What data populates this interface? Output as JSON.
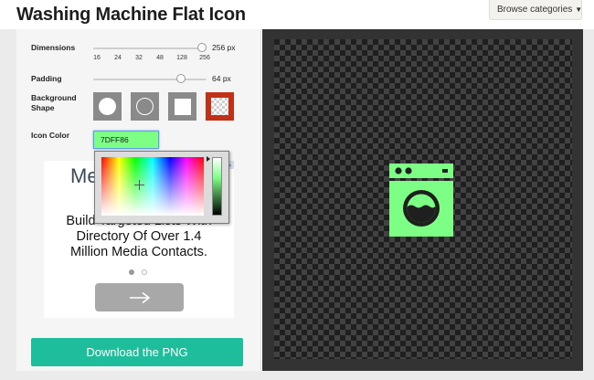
{
  "header": {
    "title": "Washing Machine Flat Icon",
    "browse_label": "Browse categories"
  },
  "controls": {
    "dimensions": {
      "label": "Dimensions",
      "value": "256 px",
      "level": 1.0,
      "ticks": [
        "16",
        "24",
        "32",
        "48",
        "128",
        "256"
      ]
    },
    "padding": {
      "label": "Padding",
      "value": "64 px",
      "level": 0.8
    },
    "background_shape": {
      "label_line1": "Background",
      "label_line2": "Shape",
      "options": [
        "circle-filled",
        "circle-outline",
        "square",
        "transparent"
      ],
      "selected": "transparent"
    },
    "icon_color": {
      "label": "Icon Color",
      "value": "7DFF86"
    }
  },
  "ad": {
    "logo_text": "Me",
    "text_line1": "Build Targeted Lists With",
    "text_line2": "Directory Of Over 1.4",
    "text_line3": "Million Media Contacts.",
    "arrow": "→"
  },
  "download": {
    "label": "Download the PNG"
  },
  "colors": {
    "icon": "#7DFF86",
    "accent": "#1EBD9B",
    "selected_shape": "#C33018"
  }
}
